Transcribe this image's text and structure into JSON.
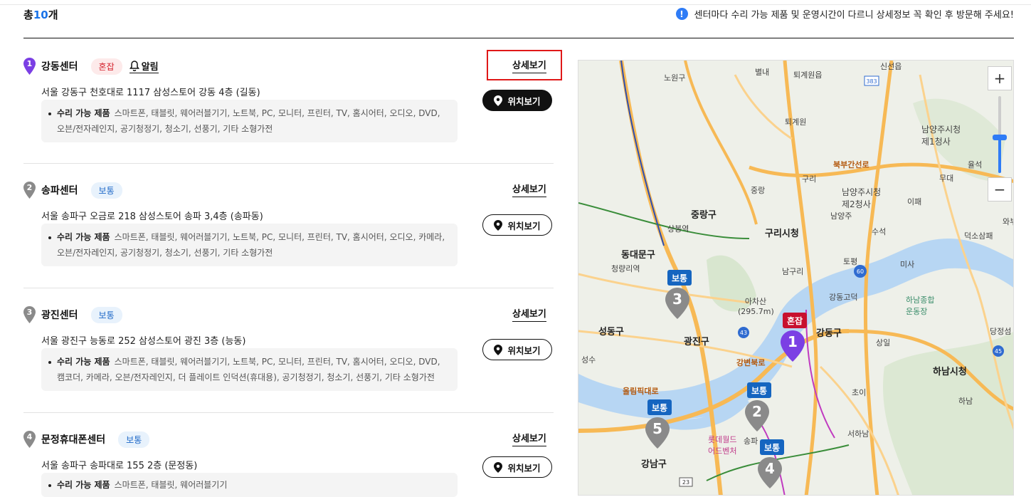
{
  "header": {
    "total_prefix": "총",
    "total_count": "10",
    "total_suffix": "개",
    "notice": "센터마다 수리 가능 제품 및 운영시간이 다르니 상세정보 꼭 확인 후 방문해 주세요!"
  },
  "labels": {
    "alarm": "알림",
    "detail": "상세보기",
    "location": "위치보기",
    "repair_label": "수리 가능 제품"
  },
  "centers": [
    {
      "no": "1",
      "name": "강동센터",
      "status": "혼잡",
      "address": "서울 강동구 천호대로 1117 삼성스토어 강동 4층 (길동)",
      "products_line1": "스마트폰, 태블릿, 웨어러블기기, 노트북, PC, 모니터, 프린터, TV, 홈시어터, 오디오, DVD,",
      "products_line2": "오븐/전자레인지, 공기청정기, 청소기, 선풍기, 기타 소형가전"
    },
    {
      "no": "2",
      "name": "송파센터",
      "status": "보통",
      "address": "서울 송파구 오금로 218 삼성스토어 송파 3,4층 (송파동)",
      "products_line1": "스마트폰, 태블릿, 웨어러블기기, 노트북, PC, 모니터, 프린터, TV, 홈시어터, 오디오, 카메라,",
      "products_line2": "오븐/전자레인지, 공기청정기, 청소기, 선풍기, 기타 소형가전"
    },
    {
      "no": "3",
      "name": "광진센터",
      "status": "보통",
      "address": "서울 광진구 능동로 252 삼성스토어 광진 3층 (능동)",
      "products_line1": "스마트폰, 태블릿, 웨어러블기기, 노트북, PC, 모니터, 프린터, TV, 홈시어터, 오디오, DVD,",
      "products_line2": "캠코더, 카메라, 오븐/전자레인지, 더 플레이트 인덕션(휴대용), 공기청정기, 청소기, 선풍기, 기타 소형가전"
    },
    {
      "no": "4",
      "name": "문정휴대폰센터",
      "status": "보통",
      "address": "서울 송파구 송파대로 155 2층 (문정동)",
      "products_line1": "스마트폰, 태블릿, 웨어러블기기"
    }
  ],
  "map": {
    "place_labels": [
      "노원구",
      "별내",
      "퇴계원읍",
      "신선읍",
      "퇴계원",
      "남양주시청 제1청사",
      "율석",
      "무대",
      "중랑",
      "구리",
      "남양주시청 제2청사",
      "이패",
      "상봉역",
      "구리시청",
      "남양주",
      "수석",
      "덕소삼패",
      "와부",
      "동대문구",
      "청량리역",
      "남구리",
      "토평",
      "미사",
      "아차산 (295.7m)",
      "강동고덕",
      "하남종합 운동장",
      "성동구",
      "광진구",
      "강동구",
      "상일",
      "당정섬",
      "성수",
      "하남시청",
      "초이",
      "하남",
      "롯데월드 어드벤처",
      "강남구",
      "서하남",
      "송파",
      "중랑구",
      "북부간선로",
      "올림픽대로",
      "강변북로"
    ],
    "route_numbers": [
      "383",
      "60",
      "43",
      "45",
      "23"
    ],
    "markers": [
      {
        "status": "보통",
        "no": "3"
      },
      {
        "status": "혼잡",
        "no": "1"
      },
      {
        "status": "보통",
        "no": "2"
      },
      {
        "status": "보통",
        "no": "5"
      },
      {
        "status": "보통",
        "no": "4"
      }
    ],
    "zoom_in": "+",
    "zoom_out": "−"
  },
  "colors": {
    "busy": "#c8102e",
    "normal": "#1565c0",
    "accent": "#2f7cf6",
    "pin_active": "#7b3fe4",
    "pin_default": "#8a8a8a"
  }
}
